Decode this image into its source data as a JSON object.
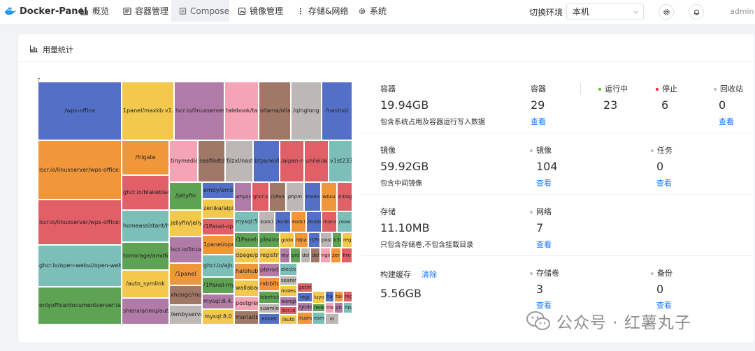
{
  "nav": {
    "brand": "Docker-Panel",
    "items": [
      {
        "label": "概览",
        "icon": "bar-chart-icon"
      },
      {
        "label": "容器管理",
        "icon": "container-icon"
      },
      {
        "label": "Compose",
        "icon": "compose-icon"
      },
      {
        "label": "镜像管理",
        "icon": "image-icon"
      },
      {
        "label": "存储&网络",
        "icon": "more-vertical-icon"
      },
      {
        "label": "系统",
        "icon": "gear-icon"
      }
    ],
    "env_label": "切换环境",
    "env_value": "本机",
    "user": "admin"
  },
  "card": {
    "title": "用量统计"
  },
  "treemap": {
    "top_label": "7",
    "cells": [
      "/wps-office",
      "lscr.io/linuxserver/wps-office:chin",
      "lscr.io/linuxserver/wps-office:late",
      "ghcr.io/open-webui/open-webui:",
      "onlyoffice/documentserver:latest",
      "1panel/maxkb:v1.5.1",
      "/frigate",
      "ghcr.io/blakeblack",
      "homeassistant/ho",
      "tomorage/amd64-l",
      "/auto_symlink",
      "shenxianmq/auto",
      "lscr.io/linuxserver/o",
      "tinymedia",
      "seafileltd/s",
      "fjlzxl/nast",
      "/jellyfin",
      "jellyfin/jellyfi",
      "lscr.io/linuxs",
      "/1panel",
      "xhongc/musi",
      "/embyserver",
      "emby/emby",
      "zenika/alpin",
      "/1Panel-ope",
      "1panel/ope",
      "ghcr.io/ajnar",
      "/1Panel-mys",
      "mysql:8.4.2",
      "mysql:8.0",
      "talebook/tale",
      "whyou",
      "ghcr.io",
      "mysql:5.7",
      "/1Panel-p",
      "dpage/pg",
      "halohub/",
      "wallabag/",
      "postgres:",
      "mariadb",
      "ollama/olla",
      "/qinglong",
      "/nastool",
      "btpanel/b",
      "/aipan-n",
      "unilei/aip",
      "v1st233/i",
      "/1Pan",
      "phpm",
      "moeli",
      "wbsu",
      "b3log",
      "kodcl",
      "/kodb",
      "kodcl",
      "/kodb",
      "maria",
      "/xiao",
      "plexinc/",
      "godo",
      "/dpa",
      "/1Pa",
      "post",
      "b3l",
      "regi",
      "registry.",
      "mys",
      "pro",
      "del",
      "del",
      "ngir",
      "zer",
      "fire",
      "pteroda",
      "electio",
      "searxn",
      "rabbitco",
      "moles",
      "lobehub",
      "getm",
      "regi",
      "suwmle",
      "wangb",
      "lscr.io",
      "/auto",
      "estrell",
      "/godoos",
      "itusha",
      "esmfs",
      "redis:",
      "luyo",
      "ha",
      "me",
      "tails",
      "reg",
      "ph",
      "hisar",
      "io",
      "jo",
      "la",
      "ja",
      "re"
    ]
  },
  "stats": {
    "container": {
      "label": "容器",
      "size": "19.94GB",
      "desc": "包含系统占用及容器运行写入数据",
      "count_label": "容器",
      "count": "29",
      "link": "查看",
      "running_label": "运行中",
      "running": "23",
      "stopped_label": "停止",
      "stopped": "6",
      "recycle_label": "回收站",
      "recycle": "0",
      "recycle_link": "查看"
    },
    "image": {
      "label": "镜像",
      "size": "59.92GB",
      "desc": "包含中间镜像",
      "count_label": "镜像",
      "count": "104",
      "link": "查看",
      "task_label": "任务",
      "task": "0",
      "task_link": "查看"
    },
    "storage": {
      "label": "存储",
      "size": "11.10MB",
      "desc": "只包含存储卷,不包含挂载目录",
      "net_label": "网络",
      "net": "7",
      "net_link": "查看"
    },
    "cache": {
      "label": "构建缓存",
      "clear": "清除",
      "size": "5.56GB",
      "vol_label": "存储卷",
      "vol": "3",
      "vol_link": "查看",
      "backup_label": "备份",
      "backup": "0",
      "backup_link": "查看"
    }
  },
  "watermark": {
    "text": "公众号 · 红薯丸子"
  },
  "colors": {
    "blue": "#5470c6",
    "yellow": "#f2c94c",
    "purple": "#b07ba6",
    "pink": "#f4a4b4",
    "brown": "#a07867",
    "grey": "#bdb7b5",
    "orange": "#f0973a",
    "red": "#e15f67",
    "teal": "#7bbfb8",
    "green": "#5ea253",
    "running": "#52c41a",
    "stopped": "#f5222d",
    "link": "#1677ff"
  }
}
